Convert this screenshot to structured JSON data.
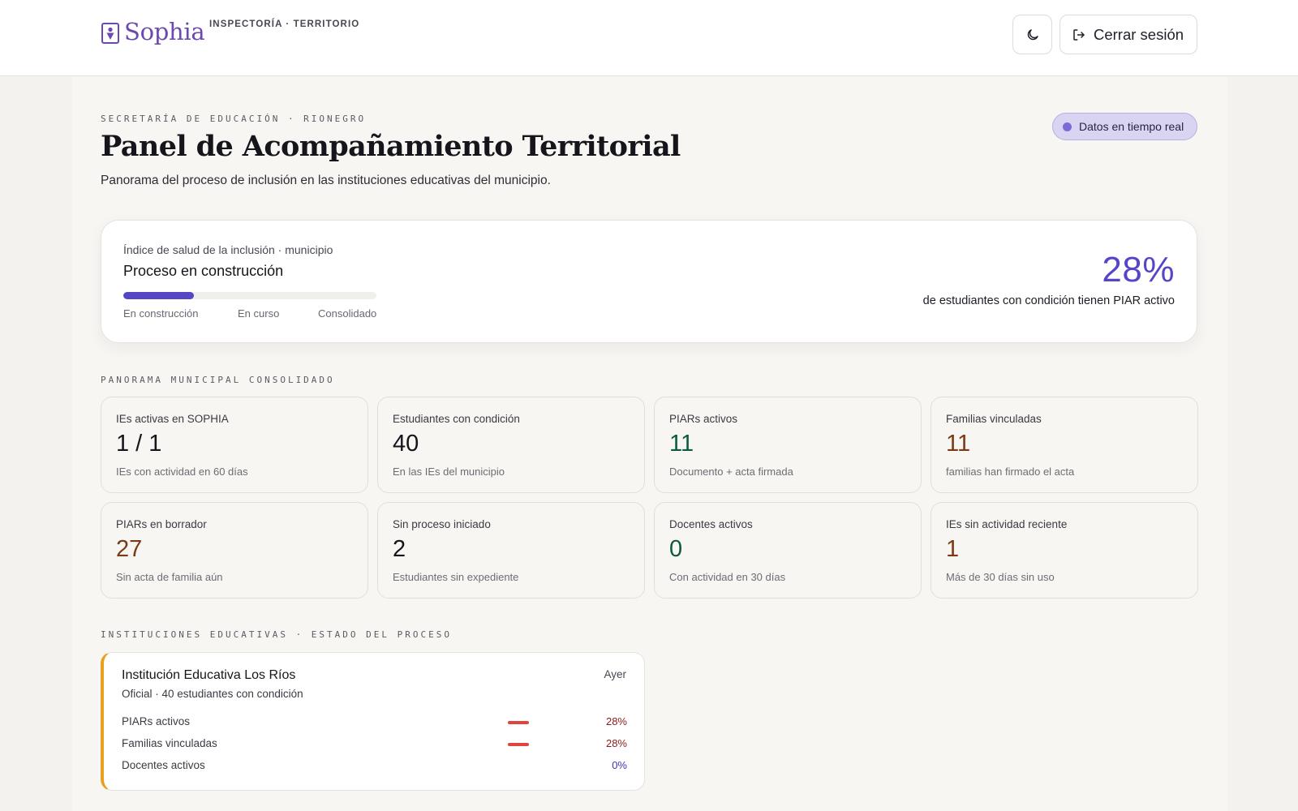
{
  "header": {
    "brand_name": "Sophia",
    "brand_subtitle": "INSPECTORÍA · TERRITORIO",
    "theme_toggle_icon": "moon-icon",
    "logout_icon": "logout-icon",
    "logout_label": "Cerrar sesión"
  },
  "hero": {
    "eyebrow": "SECRETARÍA DE EDUCACIÓN · RIONEGRO",
    "title": "Panel de Acompañamiento Territorial",
    "subtitle": "Panorama del proceso de inclusión en las instituciones educativas del municipio.",
    "live_badge": "Datos en tiempo real"
  },
  "health": {
    "kicker": "Índice de salud de la inclusión · municipio",
    "title": "Proceso en construcción",
    "progress_fraction": 0.28,
    "stages": [
      "En construcción",
      "En curso",
      "Consolidado"
    ],
    "value": "28%",
    "caption": "de estudiantes con condición tienen PIAR activo"
  },
  "stats_section_title": "PANORAMA MUNICIPAL CONSOLIDADO",
  "stats": [
    {
      "label": "IEs activas en SOPHIA",
      "value": "1 / 1",
      "sub": "IEs con actividad en 60 días",
      "tone": "default"
    },
    {
      "label": "Estudiantes con condición",
      "value": "40",
      "sub": "En las IEs del municipio",
      "tone": "default"
    },
    {
      "label": "PIARs activos",
      "value": "11",
      "sub": "Documento + acta firmada",
      "tone": "green"
    },
    {
      "label": "Familias vinculadas",
      "value": "11",
      "sub": "familias han firmado el acta",
      "tone": "brown"
    },
    {
      "label": "PIARs en borrador",
      "value": "27",
      "sub": "Sin acta de familia aún",
      "tone": "brown"
    },
    {
      "label": "Sin proceso iniciado",
      "value": "2",
      "sub": "Estudiantes sin expediente",
      "tone": "default"
    },
    {
      "label": "Docentes activos",
      "value": "0",
      "sub": "Con actividad en 30 días",
      "tone": "green"
    },
    {
      "label": "IEs sin actividad reciente",
      "value": "1",
      "sub": "Más de 30 días sin uso",
      "tone": "brown"
    }
  ],
  "institutions_section_title": "INSTITUCIONES EDUCATIVAS · ESTADO DEL PROCESO",
  "institutions": [
    {
      "name": "Institución Educativa Los Ríos",
      "last_activity": "Ayer",
      "meta": "Oficial · 40 estudiantes con condición",
      "accent_color": "#e8a11e",
      "metrics": [
        {
          "label": "PIARs activos",
          "value": "28%",
          "bar_color": "#e0443e",
          "value_color": "#8a1b1b"
        },
        {
          "label": "Familias vinculadas",
          "value": "28%",
          "bar_color": "#e0443e",
          "value_color": "#8a1b1b"
        },
        {
          "label": "Docentes activos",
          "value": "0%",
          "bar_color": "",
          "value_color": "#3c33b5"
        }
      ]
    }
  ],
  "colors": {
    "brand": "#6b49b0",
    "accent": "#5546c7",
    "positive": "#0e5a3e",
    "warning": "#7a3a14"
  }
}
